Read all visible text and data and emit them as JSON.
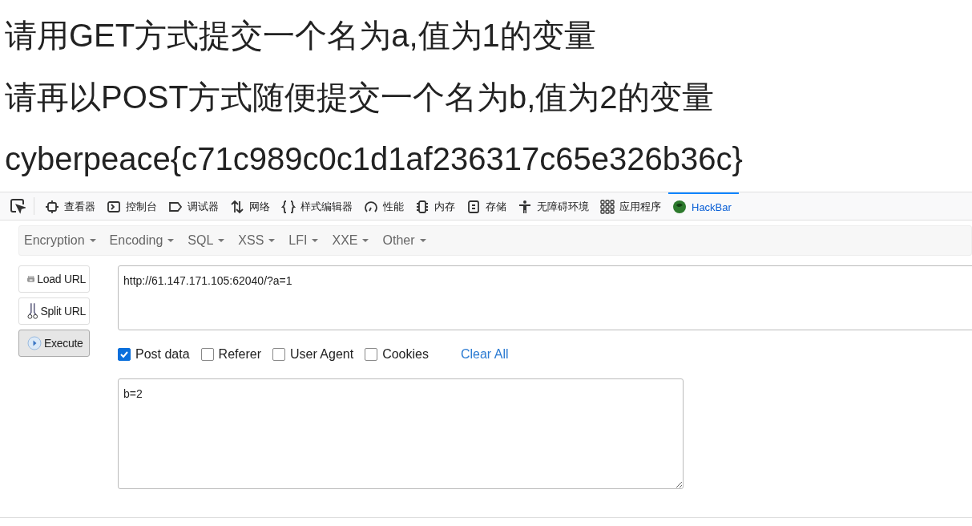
{
  "headings": [
    "请用GET方式提交一个名为a,值为1的变量",
    "请再以POST方式随便提交一个名为b,值为2的变量",
    "cyberpeace{c71c989c0c1d1af236317c65e326b36c}"
  ],
  "devtools": {
    "tabs": [
      {
        "kind": "inspector",
        "label": "查看器",
        "selected": false
      },
      {
        "kind": "console",
        "label": "控制台",
        "selected": false
      },
      {
        "kind": "debugger",
        "label": "调试器",
        "selected": false
      },
      {
        "kind": "network",
        "label": "网络",
        "selected": false
      },
      {
        "kind": "style",
        "label": "样式编辑器",
        "selected": false
      },
      {
        "kind": "performance",
        "label": "性能",
        "selected": false
      },
      {
        "kind": "memory",
        "label": "内存",
        "selected": false
      },
      {
        "kind": "storage",
        "label": "存储",
        "selected": false
      },
      {
        "kind": "accessibility",
        "label": "无障碍环境",
        "selected": false
      },
      {
        "kind": "apps",
        "label": "应用程序",
        "selected": false
      },
      {
        "kind": "hackbar",
        "label": "HackBar",
        "selected": true
      }
    ]
  },
  "hackbar": {
    "menus": [
      "Encryption",
      "Encoding",
      "SQL",
      "XSS",
      "LFI",
      "XXE",
      "Other"
    ],
    "buttons": [
      {
        "kind": "load",
        "label": "Load URL",
        "pressed": false
      },
      {
        "kind": "split",
        "label": "Split URL",
        "pressed": false
      },
      {
        "kind": "execute",
        "label": "Execute",
        "pressed": true
      }
    ],
    "url": "http://61.147.171.105:62040/?a=1",
    "options": [
      {
        "label": "Post data",
        "checked": true
      },
      {
        "label": "Referer",
        "checked": false
      },
      {
        "label": "User Agent",
        "checked": false
      },
      {
        "label": "Cookies",
        "checked": false
      }
    ],
    "clear": "Clear All",
    "post_body": "b=2"
  }
}
